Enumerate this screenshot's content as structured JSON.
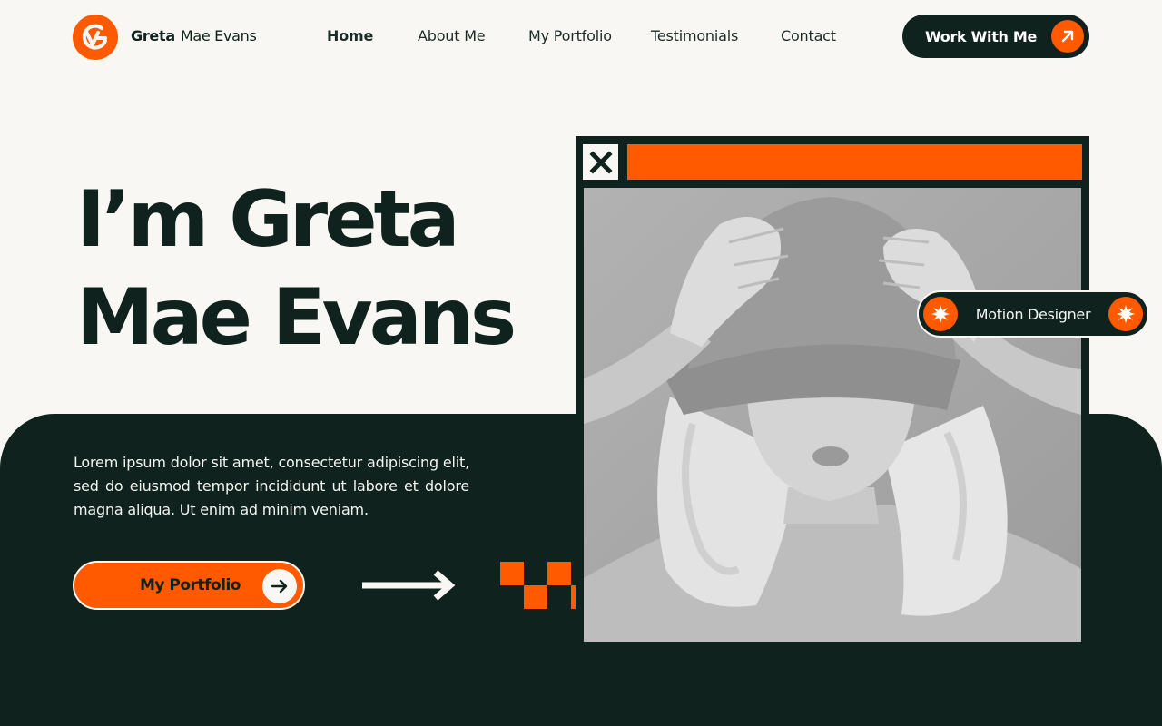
{
  "brand": {
    "first_name": "Greta",
    "rest_name": "Mae Evans"
  },
  "nav": {
    "items": [
      {
        "label": "Home",
        "active": true
      },
      {
        "label": "About Me"
      },
      {
        "label": "My Portfolio"
      },
      {
        "label": "Testimonials"
      },
      {
        "label": "Contact"
      }
    ],
    "cta_label": "Work With Me"
  },
  "hero": {
    "title_line1": "I’m Greta",
    "title_line2": "Mae Evans",
    "intro": "Lorem ipsum dolor sit amet, consectetur adipiscing elit, sed do eiusmod tempor incididunt ut labore et dolore magna aliqua. Ut enim ad minim veniam.",
    "portfolio_button": "My Portfolio",
    "badge": "Motion Designer"
  },
  "colors": {
    "accent": "#ff5a00",
    "dark": "#0f221d",
    "background": "#f8f7f3"
  },
  "icons": {
    "logo": "ge-monogram-icon",
    "cta": "arrow-up-right-icon",
    "portfolio": "arrow-right-icon",
    "badge": "starburst-icon",
    "window": "close-icon"
  }
}
